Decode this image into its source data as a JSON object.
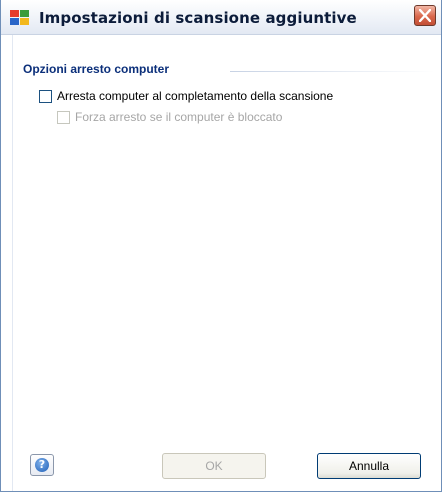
{
  "window": {
    "title": "Impostazioni di scansione aggiuntive"
  },
  "group": {
    "title": "Opzioni arresto computer"
  },
  "options": [
    {
      "label": "Arresta computer al completamento della scansione",
      "checked": false,
      "enabled": true
    },
    {
      "label": "Forza arresto se il computer è bloccato",
      "checked": false,
      "enabled": false
    }
  ],
  "buttons": {
    "ok": "OK",
    "cancel": "Annulla",
    "help_icon": "?"
  },
  "icons": {
    "app": "avg-app-icon",
    "close": "close-icon",
    "help": "help-icon"
  },
  "colors": {
    "group_title": "#0b2f7a",
    "close_button": "#d9674c",
    "disabled_text": "#a6a6a6"
  }
}
